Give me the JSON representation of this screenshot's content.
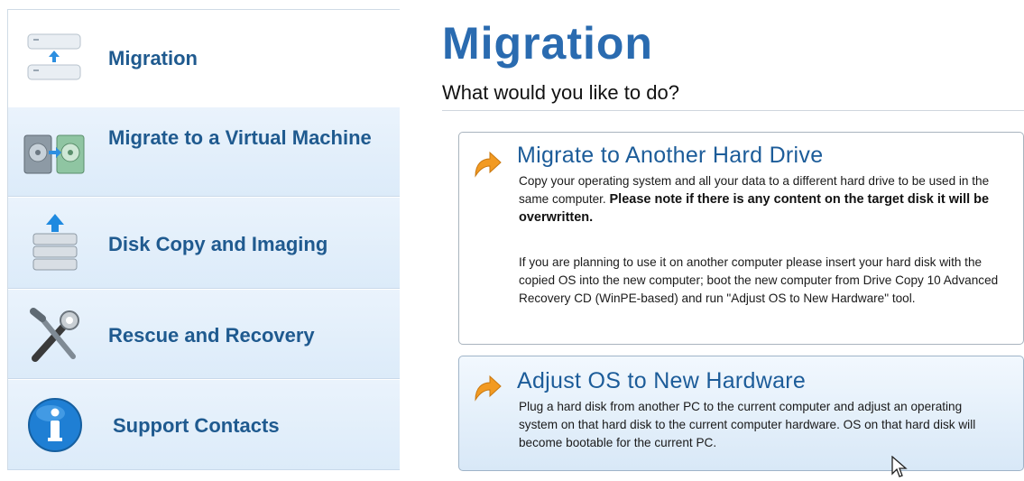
{
  "sidebar": {
    "items": [
      {
        "label": "Migration",
        "icon": "migration-drives-icon"
      },
      {
        "label": "Migrate to a Virtual Machine",
        "icon": "virtual-machine-icon"
      },
      {
        "label": "Disk Copy and Imaging",
        "icon": "disk-stack-icon"
      },
      {
        "label": "Rescue and Recovery",
        "icon": "tools-icon"
      },
      {
        "label": "Support Contacts",
        "icon": "info-icon"
      }
    ]
  },
  "main": {
    "title": "Migration",
    "subtitle": "What would you like to do?",
    "options": [
      {
        "title": "Migrate to Another Hard Drive",
        "desc1": "Copy your operating system and all your data to a different hard drive to be used in the same computer. ",
        "desc1_bold": "Please note if there is any content on the target disk it will be overwritten.",
        "desc2": "If you are planning to use it on another computer please insert your hard disk with the copied OS into the new computer; boot the new computer from Drive Copy 10 Advanced Recovery CD (WinPE-based) and run \"Adjust OS to New Hardware\" tool.",
        "icon": "orange-arrow-icon"
      },
      {
        "title": "Adjust OS to New Hardware",
        "desc1": "Plug a hard disk from another PC to the current computer and adjust an operating system on that hard disk to the current computer hardware. OS on that hard disk will become bootable for the current PC.",
        "icon": "orange-arrow-icon"
      }
    ]
  },
  "colors": {
    "accent": "#2a6bb0",
    "nav_text": "#1f5a8f",
    "option_title": "#1c5c99",
    "arrow": "#f29a22"
  }
}
